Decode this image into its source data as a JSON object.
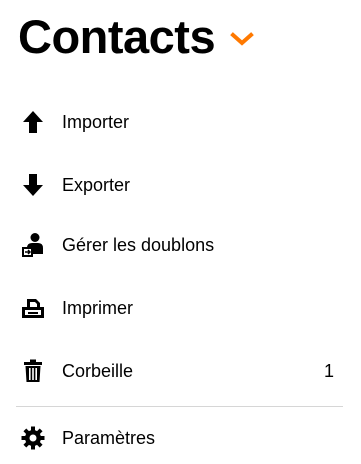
{
  "header": {
    "title": "Contacts",
    "accent_color": "#ff7900",
    "dropdown_icon": "chevron-down-icon"
  },
  "menu": {
    "items": [
      {
        "label": "Importer",
        "icon": "upload-arrow-icon"
      },
      {
        "label": "Exporter",
        "icon": "download-arrow-icon"
      },
      {
        "label": "Gérer les doublons",
        "icon": "merge-contacts-icon"
      },
      {
        "label": "Imprimer",
        "icon": "printer-icon"
      },
      {
        "label": "Corbeille",
        "icon": "trash-icon",
        "count": "1"
      },
      {
        "label": "Paramètres",
        "icon": "gear-icon"
      }
    ]
  }
}
